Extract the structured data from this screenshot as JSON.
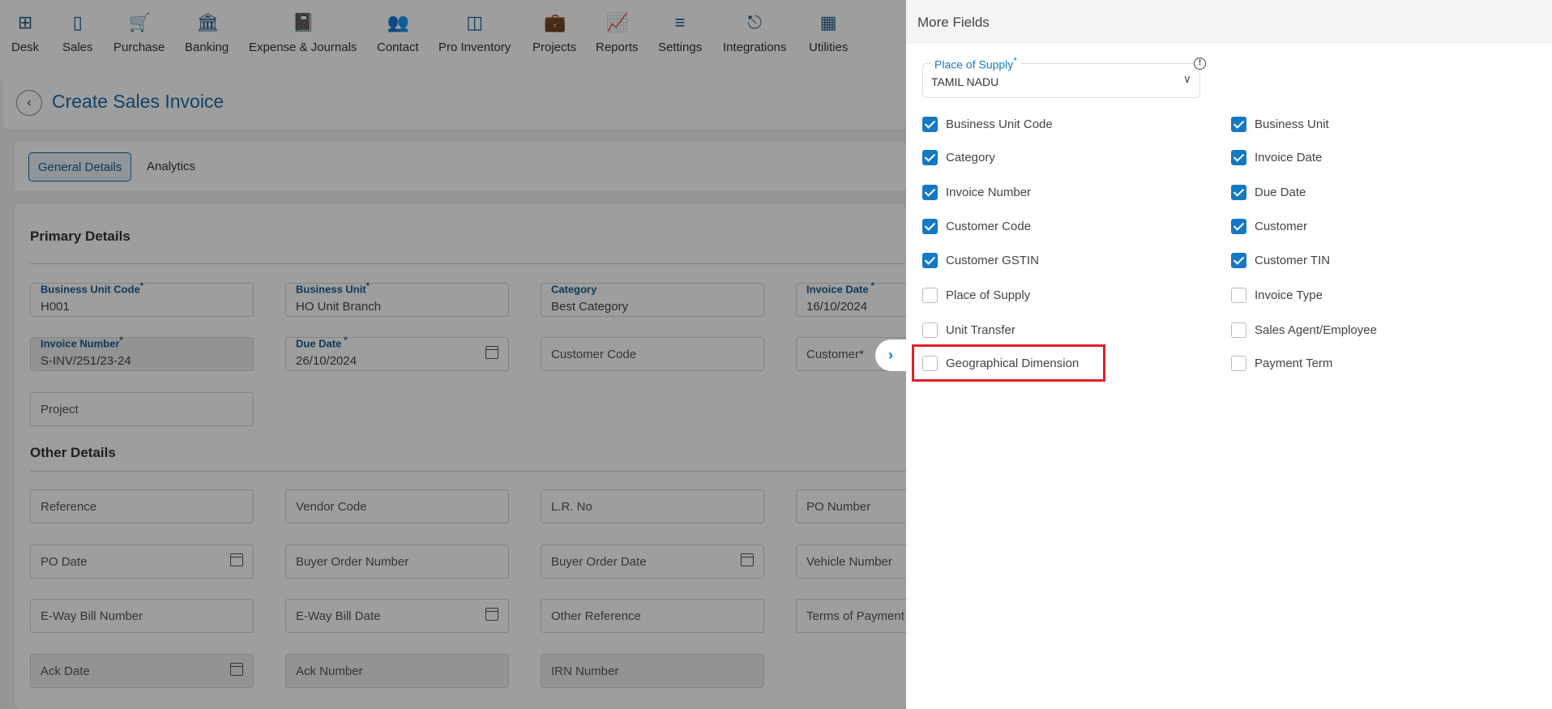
{
  "nav": [
    {
      "label": "Desk",
      "icon": "grid-plus-icon"
    },
    {
      "label": "Sales",
      "icon": "receipt-icon"
    },
    {
      "label": "Purchase",
      "icon": "cart-icon"
    },
    {
      "label": "Banking",
      "icon": "bank-icon"
    },
    {
      "label": "Expense & Journals",
      "icon": "journal-icon"
    },
    {
      "label": "Contact",
      "icon": "contacts-icon"
    },
    {
      "label": "Pro Inventory",
      "icon": "inventory-icon"
    },
    {
      "label": "Projects",
      "icon": "briefcase-icon"
    },
    {
      "label": "Reports",
      "icon": "report-icon"
    },
    {
      "label": "Settings",
      "icon": "sliders-icon"
    },
    {
      "label": "Integrations",
      "icon": "plug-icon"
    },
    {
      "label": "Utilities",
      "icon": "utilities-icon"
    }
  ],
  "page": {
    "title": "Create Sales Invoice",
    "tabs": [
      "General Details",
      "Analytics"
    ]
  },
  "primary": {
    "heading": "Primary Details",
    "fields": [
      {
        "label": "Business Unit Code",
        "req": "*",
        "value": "H001"
      },
      {
        "label": "Business Unit",
        "req": "*",
        "value": "HO Unit Branch"
      },
      {
        "label": "Category",
        "req": "",
        "value": "Best Category"
      },
      {
        "label": "Invoice Date",
        "req": " *",
        "value": "16/10/2024"
      },
      {
        "label": "Invoice Number",
        "req": "*",
        "value": "S-INV/251/23-24"
      },
      {
        "label": "Due Date",
        "req": " *",
        "value": "26/10/2024"
      },
      {
        "placeholder": "Customer Code"
      },
      {
        "placeholder": "Customer*"
      },
      {
        "placeholder": "Project"
      }
    ]
  },
  "other": {
    "heading": "Other Details",
    "fields": [
      "Reference",
      "Vendor Code",
      "L.R. No",
      "PO Number",
      "PO Date",
      "Buyer Order Number",
      "Buyer Order Date",
      "Vehicle Number",
      "E-Way Bill Number",
      "E-Way Bill Date",
      "Other Reference",
      "Terms of Payment",
      "Ack Date",
      "Ack Number",
      "IRN Number"
    ]
  },
  "panel": {
    "title": "More Fields",
    "place_of_supply": {
      "label": "Place of Supply",
      "req": "*",
      "value": "TAMIL NADU"
    },
    "checkboxes": [
      {
        "label": "Business Unit Code",
        "checked": true
      },
      {
        "label": "Business Unit",
        "checked": true
      },
      {
        "label": "Category",
        "checked": true
      },
      {
        "label": "Invoice Date",
        "checked": true
      },
      {
        "label": "Invoice Number",
        "checked": true
      },
      {
        "label": "Due Date",
        "checked": true
      },
      {
        "label": "Customer Code",
        "checked": true
      },
      {
        "label": "Customer",
        "checked": true
      },
      {
        "label": "Customer GSTIN",
        "checked": true
      },
      {
        "label": "Customer TIN",
        "checked": true
      },
      {
        "label": "Place of Supply",
        "checked": false
      },
      {
        "label": "Invoice Type",
        "checked": false
      },
      {
        "label": "Unit Transfer",
        "checked": false
      },
      {
        "label": "Sales Agent/Employee",
        "checked": false
      },
      {
        "label": "Geographical Dimension",
        "checked": false
      },
      {
        "label": "Payment Term",
        "checked": false
      }
    ]
  },
  "colors": {
    "accent": "#1479c4",
    "highlight": "#e0202a"
  }
}
